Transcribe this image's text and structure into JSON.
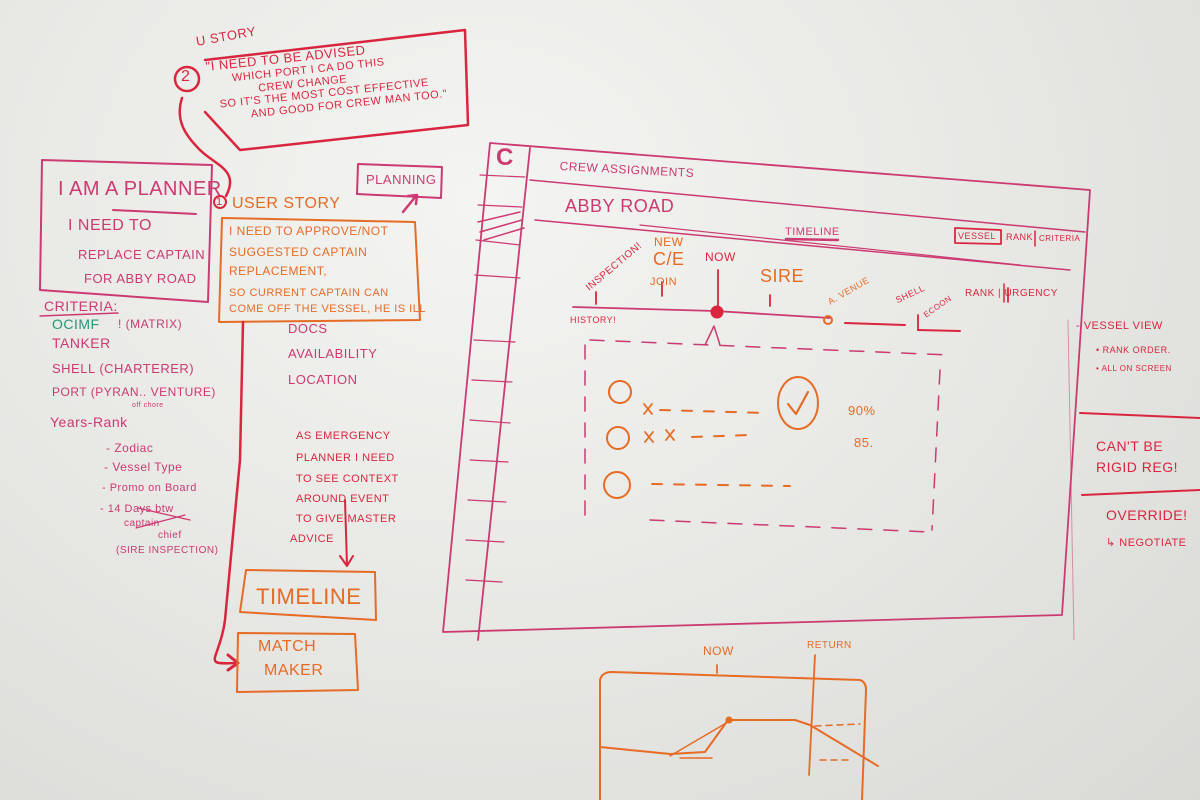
{
  "colors": {
    "red": "#d9263f",
    "pink": "#cc3a72",
    "orange": "#e66b25",
    "green": "#27957a"
  },
  "story2": {
    "label": "U Story",
    "number": "2",
    "lines": [
      "\"I need to be advised",
      "which port I ca do this",
      "crew change",
      "so it's the most cost effective",
      "and good for crew man too.\""
    ]
  },
  "planner_card": {
    "lines": [
      "I am a Planner",
      "I need to",
      "Replace captain",
      "for Abby Road"
    ]
  },
  "planning_tag": "Planning",
  "story1": {
    "number": "1",
    "label": "User Story",
    "lines": [
      "I need to approve/not",
      "suggested captain",
      "replacement,",
      "so current captain can",
      "come off the vessel, he is ill"
    ]
  },
  "needs": [
    "Docs",
    "Availability",
    "Location"
  ],
  "criteria": {
    "title": "Criteria:",
    "items": [
      {
        "text": "OCIMF",
        "extra": "! (Matrix)"
      },
      {
        "text": "Tanker"
      },
      {
        "text": "Shell (Charterer)"
      },
      {
        "text": "Port (Pyran.. Venture)",
        "note": "off chore"
      },
      {
        "text": "Years-Rank"
      }
    ],
    "sub_items": [
      "- Zodiac",
      "- Vessel Type",
      "- Promo on Board",
      "- 14 Days btw",
      "captain",
      "chief",
      "(SIRE Inspection)"
    ]
  },
  "story3": {
    "lines": [
      "As Emergency",
      "Planner I need",
      "to see context",
      "around event",
      "to give master",
      "advice"
    ]
  },
  "boxes": {
    "timeline": "Timeline",
    "matchmaker": [
      "Match",
      "Maker"
    ]
  },
  "wireframe": {
    "logo": "C",
    "app_title": "Crew Assignments",
    "vessel": "Abby Road",
    "tab": "Timeline",
    "view_toggle": [
      "Vessel",
      "Rank",
      "Criteria"
    ],
    "timeline_labels": {
      "inspection": "Inspection!",
      "new": "New",
      "ce": "C/E",
      "join": "Join",
      "now": "Now",
      "sire": "SIRE",
      "a_venue": "A. Venue",
      "shell": "Shell",
      "arrow_label": "Ecoon",
      "rank_urgency": "Rank | Urgency",
      "history": "History!"
    },
    "candidates": [
      {
        "avatar": "O",
        "score": "90%",
        "selected": true
      },
      {
        "avatar": "O",
        "score": "85."
      },
      {
        "avatar": "O",
        "score": ""
      }
    ]
  },
  "side_notes": {
    "vessel_view": "- Vessel view",
    "bullets": [
      "• Rank order.",
      "• All on screen"
    ],
    "rigid": [
      "Can't be",
      "rigid reg!"
    ],
    "override": "Override!",
    "negotiate": "↳ Negotiate"
  },
  "bottom_sketch": {
    "now": "Now",
    "return": "Return"
  }
}
